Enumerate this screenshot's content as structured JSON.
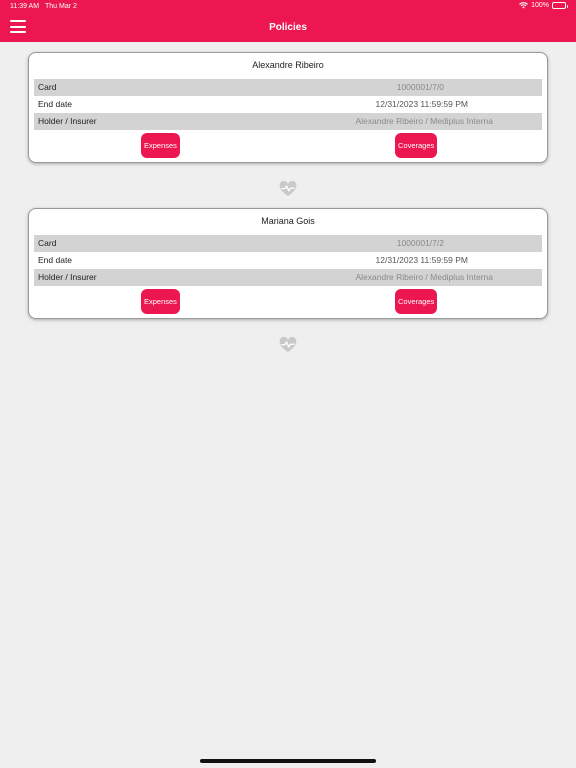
{
  "status_bar": {
    "time": "11:39 AM",
    "date": "Thu Mar 2",
    "battery": "100%"
  },
  "header": {
    "title": "Policies"
  },
  "labels": {
    "card": "Card",
    "end_date": "End date",
    "holder_insurer": "Holder / Insurer"
  },
  "buttons": {
    "expenses": "Expenses",
    "coverages": "Coverages"
  },
  "policies": [
    {
      "name": "Alexandre Ribeiro",
      "card": "1000001/7/0",
      "end_date": "12/31/2023 11:59:59 PM",
      "holder_insurer": "Alexandre Ribeiro / Mediplus Interna"
    },
    {
      "name": "Mariana Gois",
      "card": "1000001/7/2",
      "end_date": "12/31/2023 11:59:59 PM",
      "holder_insurer": "Alexandre Ribeiro / Mediplus Interna"
    }
  ],
  "colors": {
    "accent": "#ec1650",
    "background": "#efefef",
    "row_shade": "#d3d3d3"
  },
  "icons": {
    "menu": "hamburger-menu-icon",
    "heart": "heart-pulse-icon",
    "wifi": "wifi-icon",
    "battery": "battery-icon"
  }
}
